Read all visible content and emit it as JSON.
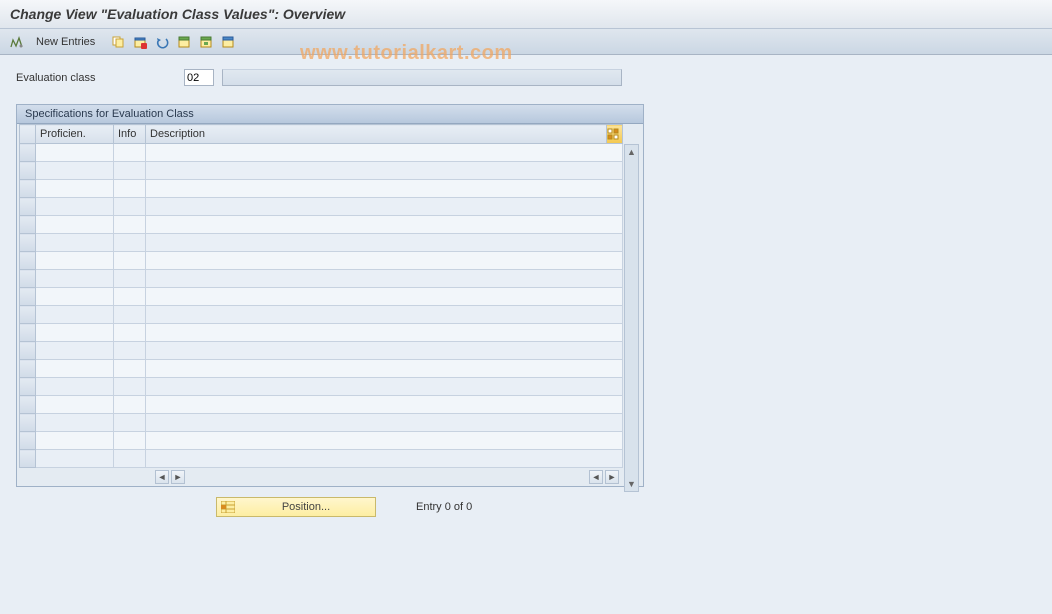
{
  "title": "Change View \"Evaluation Class Values\": Overview",
  "toolbar": {
    "new_entries_label": "New Entries"
  },
  "fields": {
    "evaluation_class_label": "Evaluation class",
    "evaluation_class_value": "02"
  },
  "panel": {
    "header": "Specifications for Evaluation Class",
    "columns": {
      "proficien": "Proficien.",
      "info": "Info",
      "description": "Description"
    }
  },
  "footer": {
    "position_label": "Position...",
    "entry_text": "Entry 0 of 0"
  },
  "watermark": "www.tutorialkart.com",
  "icons": {
    "toggle": "toggle-icon",
    "copy": "copy-icon",
    "delete": "delete-icon",
    "undo": "undo-icon",
    "select_all": "select-all-icon",
    "select_block": "select-block-icon",
    "deselect": "deselect-icon"
  }
}
